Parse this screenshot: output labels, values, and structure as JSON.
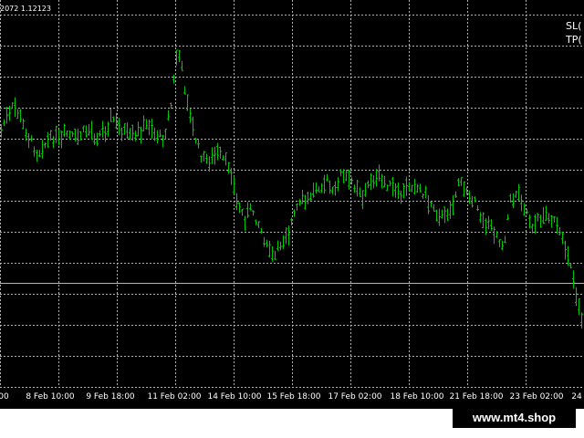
{
  "ohlc_text": "2072 1.12123",
  "sl_text": "SL(",
  "tp_text": "TP(",
  "watermark": "www.mt4.shop",
  "colors": {
    "background": "#000000",
    "grid": "#b4b4b4",
    "bars": "#00c800",
    "text": "#ffffff"
  },
  "chart_data": {
    "type": "line",
    "xlabel": "",
    "ylabel": "",
    "grid": true,
    "x_ticks": [
      "00",
      "8 Feb 10:00",
      "9 Feb 18:00",
      "11 Feb 02:00",
      "14 Feb 10:00",
      "15 Feb 18:00",
      "17 Feb 02:00",
      "18 Feb 10:00",
      "21 Feb 18:00",
      "23 Feb 02:00",
      "24"
    ],
    "series": [
      {
        "values": [
          0.63,
          0.68,
          0.72,
          0.66,
          0.6,
          0.55,
          0.58,
          0.6,
          0.59,
          0.62,
          0.6,
          0.62,
          0.64,
          0.6,
          0.63,
          0.68,
          0.65,
          0.62,
          0.6,
          0.63,
          0.66,
          0.62,
          0.6,
          0.7,
          0.93,
          0.78,
          0.64,
          0.55,
          0.52,
          0.55,
          0.53,
          0.5,
          0.38,
          0.32,
          0.36,
          0.3,
          0.22,
          0.18,
          0.24,
          0.28,
          0.35,
          0.38,
          0.4,
          0.44,
          0.46,
          0.4,
          0.48,
          0.46,
          0.44,
          0.4,
          0.45,
          0.46,
          0.45,
          0.42,
          0.4,
          0.43,
          0.44,
          0.42,
          0.38,
          0.35,
          0.32,
          0.36,
          0.45,
          0.42,
          0.38,
          0.32,
          0.3,
          0.28,
          0.22,
          0.38,
          0.42,
          0.36,
          0.3,
          0.32,
          0.34,
          0.3,
          0.24,
          0.18,
          0.05,
          -0.06
        ]
      }
    ]
  }
}
